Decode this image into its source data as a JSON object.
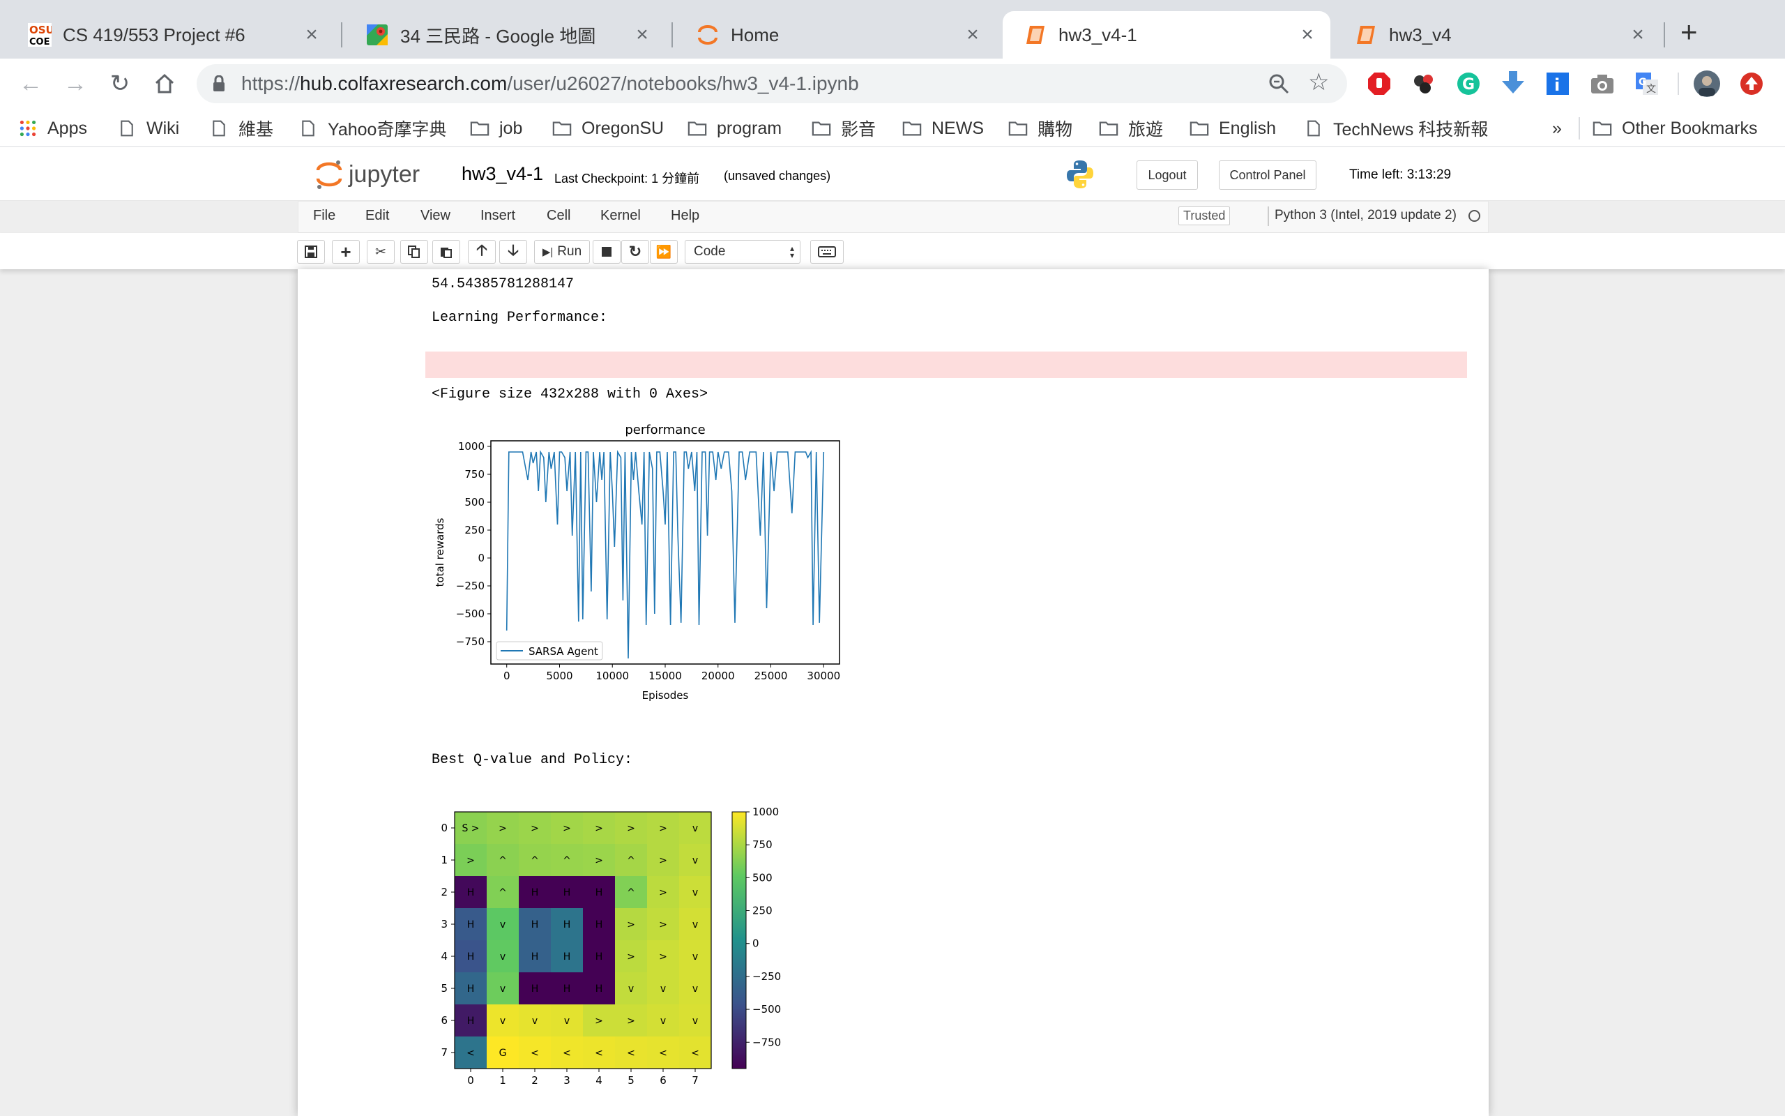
{
  "browser": {
    "tabs": [
      {
        "title": "CS 419/553 Project #6",
        "icon": "osu-coe-icon"
      },
      {
        "title": "34 三民路 - Google 地圖",
        "icon": "google-maps-icon"
      },
      {
        "title": "Home",
        "icon": "jupyter-icon"
      },
      {
        "title": "hw3_v4-1",
        "icon": "notebook-icon",
        "active": true
      },
      {
        "title": "hw3_v4",
        "icon": "notebook-icon"
      }
    ],
    "new_tab": "+",
    "url_prefix": "https://",
    "url_host": "hub.colfaxresearch.com",
    "url_path": "/user/u26027/notebooks/hw3_v4-1.ipynb",
    "bookmarks": [
      {
        "label": "Apps",
        "icon": "apps-grid-icon"
      },
      {
        "label": "Wiki",
        "icon": "page-icon"
      },
      {
        "label": "維基",
        "icon": "page-icon"
      },
      {
        "label": "Yahoo奇摩字典",
        "icon": "page-icon"
      },
      {
        "label": "job",
        "icon": "folder-icon"
      },
      {
        "label": "OregonSU",
        "icon": "folder-icon"
      },
      {
        "label": "program",
        "icon": "folder-icon"
      },
      {
        "label": "影音",
        "icon": "folder-icon"
      },
      {
        "label": "NEWS",
        "icon": "folder-icon"
      },
      {
        "label": "購物",
        "icon": "folder-icon"
      },
      {
        "label": "旅遊",
        "icon": "folder-icon"
      },
      {
        "label": "English",
        "icon": "folder-icon"
      },
      {
        "label": "TechNews 科技新報",
        "icon": "page-icon"
      }
    ],
    "overflow": "»",
    "other_bookmarks": "Other Bookmarks"
  },
  "jupyter": {
    "logo_text": "jupyter",
    "notebook_name": "hw3_v4-1",
    "checkpoint": "Last Checkpoint: 1 分鐘前",
    "unsaved": "(unsaved changes)",
    "logout": "Logout",
    "control_panel": "Control Panel",
    "time_left": "Time left: 3:13:29",
    "menus": [
      "File",
      "Edit",
      "View",
      "Insert",
      "Cell",
      "Kernel",
      "Help"
    ],
    "trusted": "Trusted",
    "kernel": "Python 3 (Intel, 2019 update 2)",
    "run_label": "Run",
    "cell_type": "Code"
  },
  "output": {
    "line1": "54.54385781288147",
    "line2": "Learning Performance:",
    "line3": "<Figure size 432x288 with 0 Axes>",
    "line4": "Best Q-value and Policy:"
  },
  "chart_data": [
    {
      "type": "line",
      "title": "performance",
      "xlabel": "Episodes",
      "ylabel": "total rewards",
      "xlim": [
        -1500,
        31500
      ],
      "ylim": [
        -950,
        1050
      ],
      "xticks": [
        0,
        5000,
        10000,
        15000,
        20000,
        25000,
        30000
      ],
      "yticks": [
        1000,
        750,
        500,
        250,
        0,
        -250,
        -500,
        -750
      ],
      "xtick_labels": [
        "0",
        "5000",
        "10000",
        "15000",
        "20000",
        "25000",
        "30000"
      ],
      "ytick_labels": [
        "1000",
        "750",
        "500",
        "250",
        "0",
        "−250",
        "−500",
        "−750"
      ],
      "legend": "lower-left",
      "color": "#1f77b4",
      "series": [
        {
          "name": "SARSA Agent",
          "x": [
            0,
            200,
            400,
            1000,
            1500,
            2000,
            2300,
            2500,
            2800,
            3000,
            3200,
            3500,
            3700,
            4000,
            4200,
            4500,
            4800,
            5000,
            5200,
            5500,
            5700,
            6000,
            6200,
            6500,
            6800,
            7000,
            7200,
            7500,
            7700,
            8000,
            8200,
            8500,
            8800,
            9000,
            9200,
            9500,
            9800,
            10000,
            10200,
            10500,
            10800,
            11000,
            11200,
            11500,
            11800,
            12000,
            12200,
            12500,
            12800,
            13000,
            13200,
            13500,
            13800,
            14000,
            14200,
            14500,
            14800,
            15000,
            15200,
            15500,
            15800,
            16000,
            16200,
            16500,
            16800,
            17000,
            17200,
            17500,
            17800,
            18000,
            18200,
            18500,
            18800,
            19000,
            19200,
            19500,
            19800,
            20000,
            20300,
            20600,
            21000,
            21300,
            21600,
            22000,
            22300,
            22600,
            23000,
            23300,
            23600,
            24000,
            24300,
            24600,
            25000,
            25300,
            25600,
            26000,
            26300,
            26600,
            27000,
            27300,
            27600,
            28000,
            28300,
            28500,
            28800,
            29000,
            29300,
            29600,
            30000
          ],
          "y": [
            -650,
            950,
            950,
            950,
            950,
            700,
            950,
            850,
            950,
            600,
            950,
            900,
            500,
            950,
            800,
            950,
            300,
            950,
            950,
            900,
            600,
            950,
            200,
            950,
            -570,
            950,
            -550,
            950,
            950,
            -300,
            950,
            500,
            950,
            700,
            950,
            -550,
            950,
            600,
            100,
            950,
            900,
            -380,
            950,
            -900,
            950,
            700,
            950,
            600,
            300,
            950,
            -600,
            950,
            800,
            -500,
            950,
            950,
            600,
            300,
            950,
            -600,
            950,
            950,
            200,
            -580,
            950,
            950,
            800,
            950,
            600,
            950,
            -600,
            950,
            950,
            200,
            950,
            950,
            700,
            950,
            800,
            950,
            950,
            600,
            -580,
            950,
            950,
            700,
            950,
            950,
            950,
            200,
            950,
            -450,
            950,
            600,
            950,
            950,
            950,
            950,
            400,
            950,
            950,
            950,
            950,
            900,
            950,
            -600,
            950,
            -580,
            950
          ]
        }
      ]
    },
    {
      "type": "heatmap",
      "title": "",
      "xlabel": "",
      "ylabel": "",
      "xtick_labels": [
        "0",
        "1",
        "2",
        "3",
        "4",
        "5",
        "6",
        "7"
      ],
      "ytick_labels": [
        "0",
        "1",
        "2",
        "3",
        "4",
        "5",
        "6",
        "7"
      ],
      "colormap": "viridis",
      "vmin": -950,
      "vmax": 1000,
      "colorbar_ticks": [
        1000,
        750,
        500,
        250,
        0,
        -250,
        -500,
        -750
      ],
      "colorbar_tick_labels": [
        "1000",
        "750",
        "500",
        "250",
        "0",
        "−250",
        "−500",
        "−750"
      ],
      "values": [
        [
          650,
          680,
          700,
          720,
          740,
          760,
          780,
          800
        ],
        [
          600,
          650,
          680,
          690,
          700,
          730,
          780,
          820
        ],
        [
          -900,
          620,
          -950,
          -950,
          -950,
          620,
          800,
          850
        ],
        [
          -400,
          500,
          -350,
          -200,
          -950,
          780,
          820,
          870
        ],
        [
          -450,
          520,
          -350,
          -200,
          -950,
          800,
          850,
          880
        ],
        [
          -300,
          560,
          -950,
          -950,
          -950,
          820,
          850,
          880
        ],
        [
          -800,
          950,
          930,
          920,
          850,
          850,
          870,
          890
        ],
        [
          -200,
          1000,
          980,
          960,
          950,
          940,
          930,
          920
        ]
      ],
      "labels": [
        [
          "S >",
          ">",
          ">",
          ">",
          ">",
          ">",
          ">",
          "v"
        ],
        [
          ">",
          "^",
          "^",
          "^",
          ">",
          "^",
          ">",
          "v"
        ],
        [
          "H",
          "^",
          "H",
          "H",
          "H",
          "^",
          ">",
          "v"
        ],
        [
          "H",
          "v",
          "H",
          "H",
          "H",
          ">",
          ">",
          "v"
        ],
        [
          "H",
          "v",
          "H",
          "H",
          "H",
          ">",
          ">",
          "v"
        ],
        [
          "H",
          "v",
          "H",
          "H",
          "H",
          "v",
          "v",
          "v"
        ],
        [
          "H",
          "v",
          "v",
          "v",
          ">",
          ">",
          "v",
          "v"
        ],
        [
          "<",
          "G",
          "<",
          "<",
          "<",
          "<",
          "<",
          "<"
        ]
      ]
    }
  ]
}
